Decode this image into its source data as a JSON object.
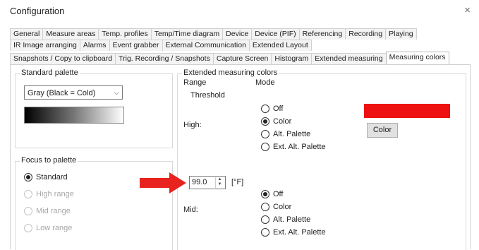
{
  "window": {
    "title": "Configuration",
    "close_glyph": "×"
  },
  "tabs": {
    "row1": [
      "General",
      "Measure areas",
      "Temp. profiles",
      "Temp/Time diagram",
      "Device",
      "Device (PIF)",
      "Referencing",
      "Recording",
      "Playing"
    ],
    "row2": [
      "IR Image arranging",
      "Alarms",
      "Event grabber",
      "External Communication",
      "Extended Layout"
    ],
    "row3": [
      "Snapshots / Copy to clipboard",
      "Trig. Recording / Snapshots",
      "Capture Screen",
      "Histogram",
      "Extended measuring",
      "Measuring colors"
    ],
    "active": "Measuring colors"
  },
  "standard_palette": {
    "label": "Standard palette",
    "selected": "Gray (Black = Cold)"
  },
  "focus_to_palette": {
    "label": "Focus to palette",
    "options": [
      "Standard",
      "High range",
      "Mid range",
      "Low range"
    ],
    "selected": "Standard"
  },
  "extended_colors": {
    "label": "Extended measuring colors",
    "range_header": "Range",
    "mode_header": "Mode",
    "threshold_label": "Threshold",
    "high": {
      "label": "High:",
      "options": [
        "Off",
        "Color",
        "Alt. Palette",
        "Ext. Alt. Palette"
      ],
      "selected": "Color",
      "color": "#ee1111",
      "color_button": "Color"
    },
    "threshold": {
      "value": "99.0",
      "unit": "[°F]"
    },
    "mid": {
      "label": "Mid:",
      "options": [
        "Off",
        "Color",
        "Alt. Palette",
        "Ext. Alt. Palette"
      ],
      "selected": "Off"
    }
  },
  "annotation": {
    "arrow_color": "#e8231f"
  },
  "icons": {
    "close": "close-icon",
    "dropdown": "chevron-down-icon",
    "spin": "spin-arrows-icon",
    "pointer": "red-arrow-icon"
  }
}
